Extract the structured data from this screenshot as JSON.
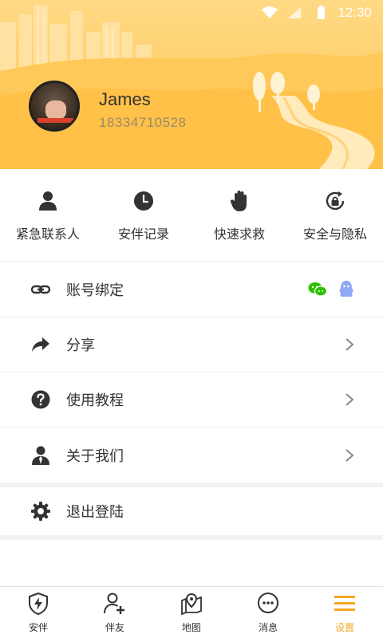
{
  "status_bar": {
    "time": "12:30"
  },
  "profile": {
    "name": "James",
    "phone": "18334710528"
  },
  "quick_actions": [
    {
      "label": "紧急联系人",
      "icon": "person-icon"
    },
    {
      "label": "安伴记录",
      "icon": "clock-icon"
    },
    {
      "label": "快速求救",
      "icon": "hand-icon"
    },
    {
      "label": "安全与隐私",
      "icon": "lock-refresh-icon"
    }
  ],
  "menu": {
    "account_binding": "账号绑定",
    "share": "分享",
    "tutorial": "使用教程",
    "about": "关于我们",
    "logout": "退出登陆"
  },
  "tabs": [
    {
      "label": "安伴",
      "icon": "shield-bolt-icon"
    },
    {
      "label": "伴友",
      "icon": "add-friend-icon"
    },
    {
      "label": "地图",
      "icon": "map-pin-icon"
    },
    {
      "label": "消息",
      "icon": "chat-bubble-icon"
    },
    {
      "label": "设置",
      "icon": "menu-icon",
      "active": true
    }
  ],
  "colors": {
    "accent": "#f5a623",
    "header": "#ffcf6a",
    "wechat": "#2dc100",
    "qq": "#8fa9f5"
  }
}
